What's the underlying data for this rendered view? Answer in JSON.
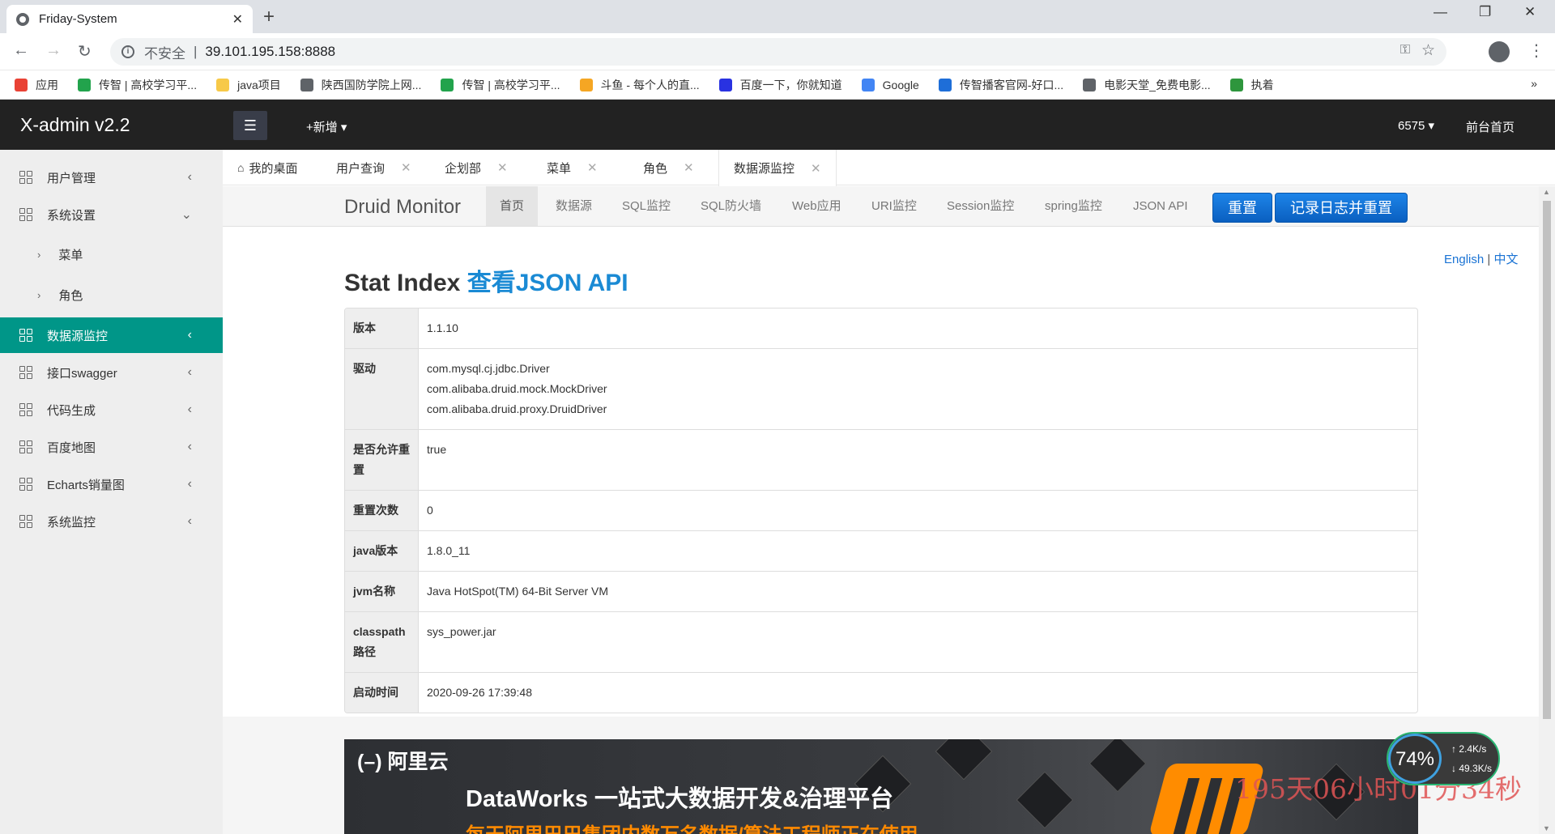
{
  "browser": {
    "tab_title": "Friday-System",
    "tab_close": "✕",
    "new_tab": "+",
    "minimize": "—",
    "restore": "❐",
    "close": "✕",
    "back": "←",
    "forward": "→",
    "reload": "↻",
    "security_label": "不安全",
    "separator": "|",
    "url": "39.101.195.158:8888",
    "bookmarks": [
      {
        "label": "应用",
        "icon": "apps-icon",
        "color": "#e94235"
      },
      {
        "label": "传智 | 高校学习平...",
        "icon": "bookmark-icon",
        "color": "#22a34c"
      },
      {
        "label": "java项目",
        "icon": "folder-icon",
        "color": "#f7c948"
      },
      {
        "label": "陕西国防学院上网...",
        "icon": "globe-icon",
        "color": "#5f6368"
      },
      {
        "label": "传智 | 高校学习平...",
        "icon": "bookmark-icon",
        "color": "#22a34c"
      },
      {
        "label": "斗鱼 - 每个人的直...",
        "icon": "douyu-icon",
        "color": "#f5a623"
      },
      {
        "label": "百度一下，你就知道",
        "icon": "baidu-icon",
        "color": "#2932e1"
      },
      {
        "label": "Google",
        "icon": "google-icon",
        "color": "#4285f4"
      },
      {
        "label": "传智播客官网-好口...",
        "icon": "chuanzhi-icon",
        "color": "#1e6ed8"
      },
      {
        "label": "电影天堂_免费电影...",
        "icon": "globe-icon",
        "color": "#5f6368"
      },
      {
        "label": "执着",
        "icon": "douban-icon",
        "color": "#2e963d"
      }
    ],
    "bookmarks_more": "»"
  },
  "header": {
    "logo": "X-admin v2.2",
    "menu_icon": "☰",
    "add_new": "+新增 ▾",
    "user": "6575 ▾",
    "front_page": "前台首页"
  },
  "sidebar": {
    "items": [
      {
        "label": "用户管理",
        "arrow": "‹"
      },
      {
        "label": "系统设置",
        "arrow": "⌄"
      },
      {
        "label": "菜单",
        "arrow": "›"
      },
      {
        "label": "角色",
        "arrow": "›"
      },
      {
        "label": "数据源监控",
        "arrow": "‹"
      },
      {
        "label": "接口swagger",
        "arrow": "‹"
      },
      {
        "label": "代码生成",
        "arrow": "‹"
      },
      {
        "label": "百度地图",
        "arrow": "‹"
      },
      {
        "label": "Echarts销量图",
        "arrow": "‹"
      },
      {
        "label": "系统监控",
        "arrow": "‹"
      }
    ]
  },
  "page_tabs": [
    {
      "label": "我的桌面"
    },
    {
      "label": "用户查询"
    },
    {
      "label": "企划部"
    },
    {
      "label": "菜单"
    },
    {
      "label": "角色"
    },
    {
      "label": "数据源监控"
    }
  ],
  "druid": {
    "brand": "Druid Monitor",
    "nav": [
      "首页",
      "数据源",
      "SQL监控",
      "SQL防火墙",
      "Web应用",
      "URI监控",
      "Session监控",
      "spring监控",
      "JSON API"
    ],
    "reset_button": "重置",
    "log_reset_button": "记录日志并重置",
    "lang_en": "English",
    "lang_sep": "|",
    "lang_zh": "中文",
    "title": "Stat Index",
    "title_link": "查看JSON API",
    "rows": [
      {
        "key": "版本",
        "value": "1.1.10"
      },
      {
        "key": "驱动",
        "value": "com.mysql.cj.jdbc.Driver\ncom.alibaba.druid.mock.MockDriver\ncom.alibaba.druid.proxy.DruidDriver"
      },
      {
        "key": "是否允许重置",
        "value": "true"
      },
      {
        "key": "重置次数",
        "value": "0"
      },
      {
        "key": "java版本",
        "value": "1.8.0_11"
      },
      {
        "key": "jvm名称",
        "value": "Java HotSpot(TM) 64-Bit Server VM"
      },
      {
        "key": "classpath路径",
        "value": "sys_power.jar"
      },
      {
        "key": "启动时间",
        "value": "2020-09-26 17:39:48"
      }
    ]
  },
  "banner": {
    "logo": "(–) 阿里云",
    "title": "DataWorks 一站式大数据开发&治理平台",
    "subtitle": "每天阿里巴巴集团内数万名数据/算法工程师正在使用"
  },
  "overlay": {
    "timer": "195天06小时01分34秒",
    "cpu": "74%",
    "upload": "↑ 2.4K/s",
    "download": "↓ 49.3K/s"
  }
}
